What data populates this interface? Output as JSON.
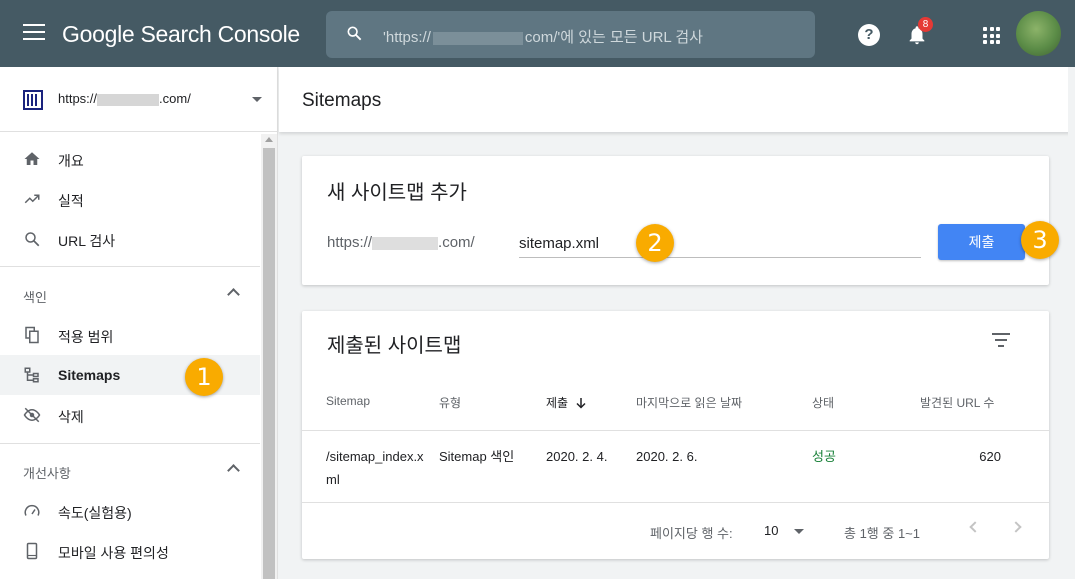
{
  "app": {
    "title": "Google Search Console",
    "search_placeholder_prefix": "'https://",
    "search_placeholder_suffix": "com/'에 있는 모든 URL 검사",
    "notification_count": "8",
    "help_glyph": "?"
  },
  "sidebar": {
    "property_prefix": "https://",
    "property_suffix": ".com/",
    "items_top": [
      {
        "label": "개요",
        "icon": "home-icon"
      },
      {
        "label": "실적",
        "icon": "trending-up-icon"
      },
      {
        "label": "URL 검사",
        "icon": "search-icon"
      }
    ],
    "section_index": "색인",
    "items_index": [
      {
        "label": "적용 범위",
        "icon": "copy-icon"
      },
      {
        "label": "Sitemaps",
        "icon": "sitemap-icon"
      },
      {
        "label": "삭제",
        "icon": "eye-off-icon"
      }
    ],
    "section_enhancements": "개선사항",
    "items_enhancements": [
      {
        "label": "속도(실험용)",
        "icon": "speed-icon"
      },
      {
        "label": "모바일 사용 편의성",
        "icon": "phone-icon"
      }
    ]
  },
  "main": {
    "page_title": "Sitemaps",
    "add_card": {
      "title": "새 사이트맵 추가",
      "url_prefix_start": "https://",
      "url_prefix_end": ".com/",
      "input_value": "sitemap.xml",
      "submit_label": "제출"
    },
    "list_card": {
      "title": "제출된 사이트맵",
      "columns": [
        "Sitemap",
        "유형",
        "제출",
        "마지막으로 읽은 날짜",
        "상태",
        "발견된 URL 수"
      ],
      "rows": [
        {
          "sitemap": "/sitemap_index.xml",
          "type": "Sitemap 색인",
          "submitted": "2020. 2. 4.",
          "last_read": "2020. 2. 6.",
          "status": "성공",
          "urls": "620"
        }
      ],
      "rows_per_page_label": "페이지당 행 수:",
      "rows_per_page_value": "10",
      "range_text": "총 1행 중 1~1"
    }
  },
  "markers": [
    "1",
    "2",
    "3"
  ],
  "colors": {
    "topbar": "#455a64",
    "accent_button": "#4285f4",
    "success": "#188038",
    "marker": "#f9ab00"
  }
}
